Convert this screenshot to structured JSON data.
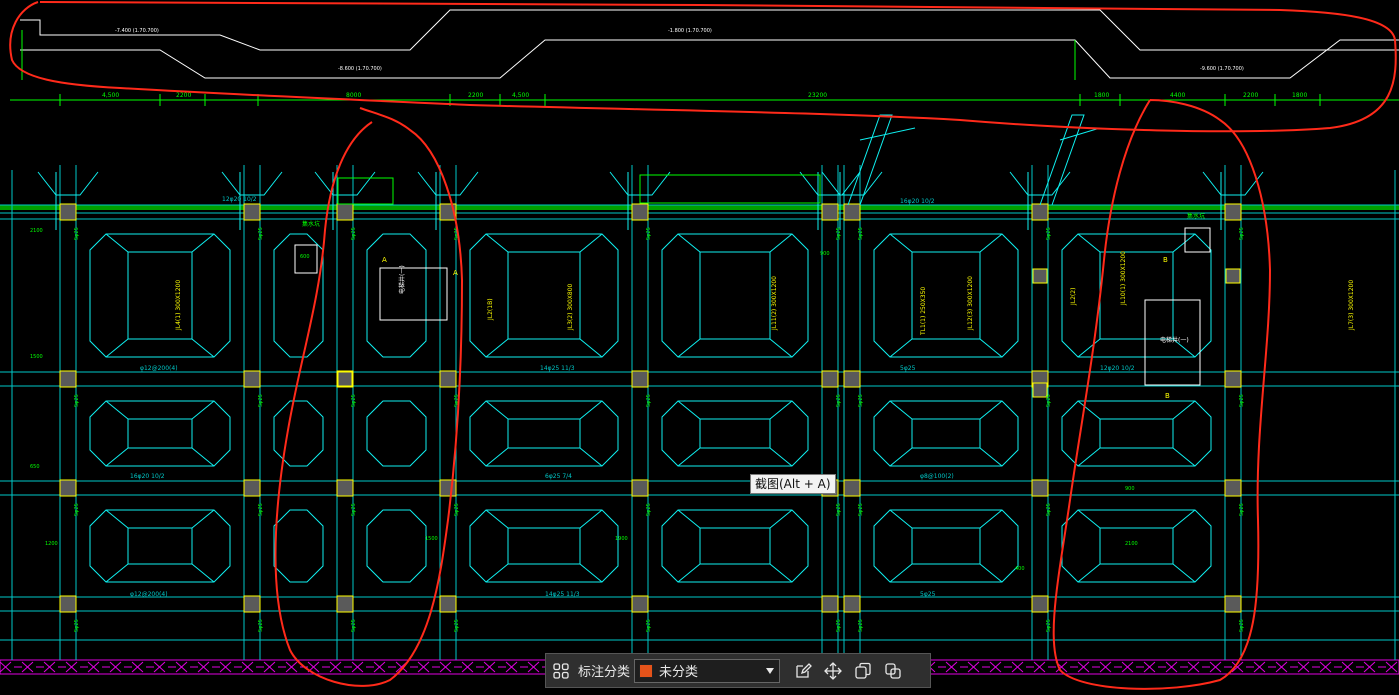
{
  "drawing": {
    "section_dims": [
      "4,500",
      "2200",
      "8000",
      "2200",
      "4,500",
      "23200",
      "1800",
      "4400",
      "2200",
      "1800"
    ],
    "elevations": [
      "-7.400 (1.70.700)",
      "-1.800 (1.70.700)",
      "-8.600 (1.70.700)",
      "-9.600 (1.70.700)"
    ],
    "beam_labels": [
      "JL4(1) 300X1200",
      "JL3(2) 300X800",
      "JL11(2) 300X1200",
      "JL12(3) 300X1200",
      "JL7(3) 300X1200",
      "JL10(1) 300X1200",
      "TL1(1) 250X350",
      "JL2(1B)",
      "JL2(2)"
    ],
    "rebar_notes": [
      "φ12@200(4)",
      "14φ25 11/3",
      "5φ25",
      "12φ20 10/2",
      "16φ20 10/2",
      "6φ25 7/4",
      "φ8@100(2)"
    ],
    "small_dims": [
      "2100",
      "1500",
      "650",
      "1200",
      "600",
      "900",
      "400",
      "900",
      "2100",
      "1500",
      "1900"
    ],
    "section_marks": [
      "A",
      "A",
      "B",
      "B"
    ],
    "tags": [
      "集水坑",
      "集水坑",
      "电梯井(一)",
      "电梯井(一)"
    ]
  },
  "tooltip": {
    "text": "截图(Alt + A)"
  },
  "toolbar": {
    "label": "标注分类",
    "category": {
      "value": "未分类",
      "color": "#e5531a"
    }
  },
  "colors": {
    "axis": "#00c8c8",
    "beam": "#0ff0f0",
    "ann": "#00ff00",
    "txt": "#ffff00",
    "dim": "#00ff00",
    "column": "#bfbfbf",
    "outline": "#ffffff",
    "markup": "#ff2a1a",
    "hatch": "#e000e0"
  }
}
